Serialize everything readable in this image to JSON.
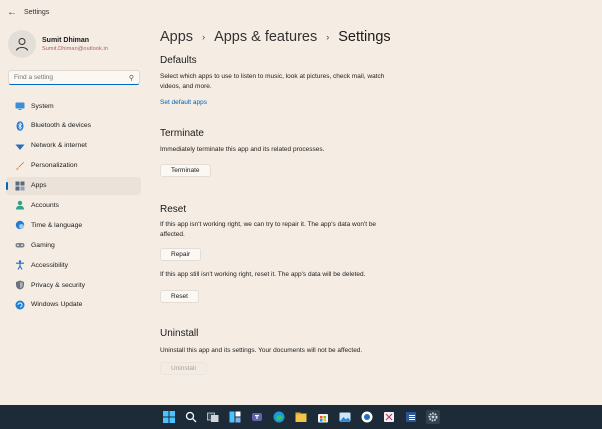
{
  "window": {
    "title": "Settings"
  },
  "profile": {
    "name": "Sumit Dhiman",
    "email": "Sumit.Dhiman@outlook.in"
  },
  "search": {
    "placeholder": "Find a setting"
  },
  "nav": [
    {
      "label": "System",
      "icon": "monitor-icon",
      "color": "#3a8fd6"
    },
    {
      "label": "Bluetooth & devices",
      "icon": "bluetooth-icon",
      "color": "#2a7bd0"
    },
    {
      "label": "Network & internet",
      "icon": "wifi-icon",
      "color": "#2a6fb8"
    },
    {
      "label": "Personalization",
      "icon": "brush-icon",
      "color": "#d06a3a"
    },
    {
      "label": "Apps",
      "icon": "apps-icon",
      "color": "#5a6a80",
      "active": true
    },
    {
      "label": "Accounts",
      "icon": "person-icon",
      "color": "#2fa38a"
    },
    {
      "label": "Time & language",
      "icon": "globe-clock-icon",
      "color": "#2a7bd0"
    },
    {
      "label": "Gaming",
      "icon": "gamepad-icon",
      "color": "#7a8088"
    },
    {
      "label": "Accessibility",
      "icon": "accessibility-icon",
      "color": "#1f6fc0"
    },
    {
      "label": "Privacy & security",
      "icon": "shield-icon",
      "color": "#6a737d"
    },
    {
      "label": "Windows Update",
      "icon": "update-icon",
      "color": "#1f7fd6"
    }
  ],
  "breadcrumb": {
    "part1": "Apps",
    "part2": "Apps & features",
    "current": "Settings",
    "separator": "›"
  },
  "defaults": {
    "title": "Defaults",
    "desc": "Select which apps to use to listen to music, look at pictures, check mail, watch videos, and more.",
    "link": "Set default apps"
  },
  "terminate": {
    "title": "Terminate",
    "desc": "Immediately terminate this app and its related processes.",
    "button": "Terminate"
  },
  "reset": {
    "title": "Reset",
    "desc1": "If this app isn't working right, we can try to repair it. The app's data won't be affected.",
    "repair_button": "Repair",
    "desc2": "If this app still isn't working right, reset it. The app's data will be deleted.",
    "reset_button": "Reset"
  },
  "uninstall": {
    "title": "Uninstall",
    "desc": "Uninstall this app and its settings. Your documents will not be affected.",
    "button": "Uninstall"
  },
  "taskbar": {
    "icons": [
      "windows-start-icon",
      "search-icon",
      "task-view-icon",
      "widgets-icon",
      "teams-chat-icon",
      "edge-icon",
      "file-explorer-icon",
      "store-icon",
      "photos-icon",
      "camera-icon",
      "snipping-icon",
      "word-icon",
      "settings-icon"
    ]
  },
  "colors": {
    "accent": "#0067c0",
    "background": "#f5ede4",
    "taskbar": "#1d2a38"
  }
}
